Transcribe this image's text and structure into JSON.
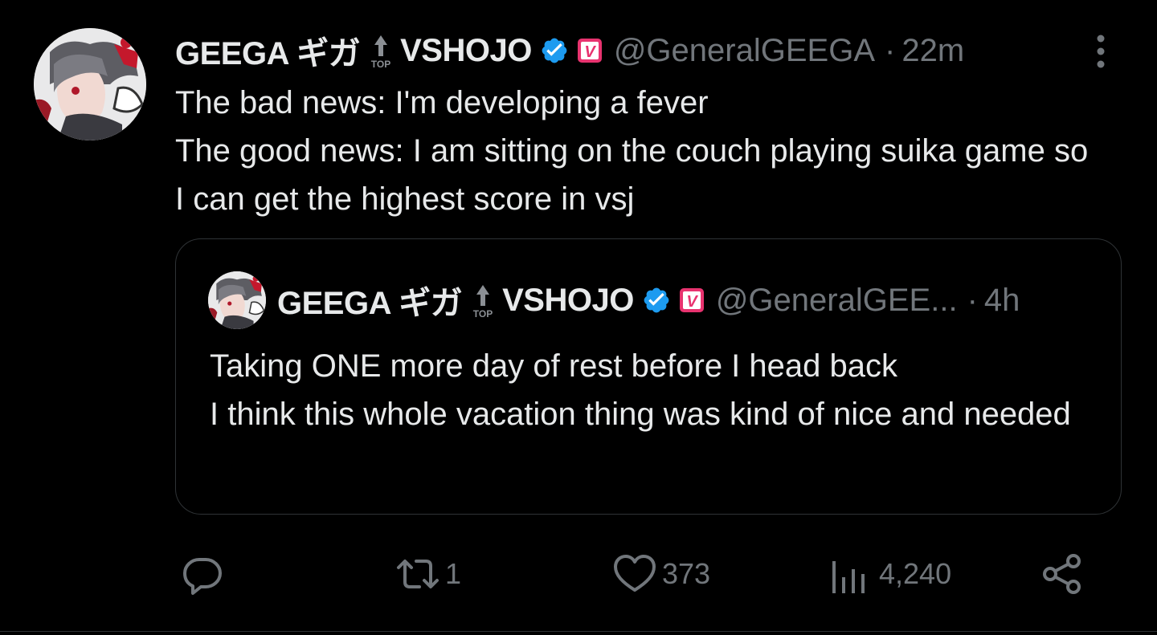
{
  "tweet": {
    "author": {
      "display_name": "GEEGA ギガ",
      "top_badge_label": "TOP",
      "org": "VSHOJO",
      "vbadge_letter": "V",
      "handle": "@GeneralGEEGA",
      "separator": "·",
      "time": "22m"
    },
    "text_lines": [
      "The bad news: I'm developing a fever",
      "The good news: I am sitting on the couch playing suika game so I can get the highest score in vsj"
    ],
    "quote": {
      "display_name": "GEEGA ギガ",
      "top_badge_label": "TOP",
      "org": "VSHOJO",
      "vbadge_letter": "V",
      "handle": "@GeneralGEE...",
      "separator": "·",
      "time": "4h",
      "text_lines": [
        "Taking ONE more day of rest before I head back",
        "I think this whole vacation thing was kind of nice and needed"
      ]
    },
    "actions": {
      "reply": {
        "icon": "reply-icon",
        "count": ""
      },
      "retweet": {
        "icon": "retweet-icon",
        "count": "1"
      },
      "like": {
        "icon": "heart-icon",
        "count": "373"
      },
      "views": {
        "icon": "views-chart-icon",
        "count": "4,240"
      },
      "share": {
        "icon": "share-icon",
        "count": ""
      }
    }
  },
  "colors": {
    "background": "#000000",
    "text": "#e7e9ea",
    "muted": "#71767b",
    "border": "#2f3336",
    "verified": "#1d9bf0",
    "vbadge": "#e8336f"
  }
}
